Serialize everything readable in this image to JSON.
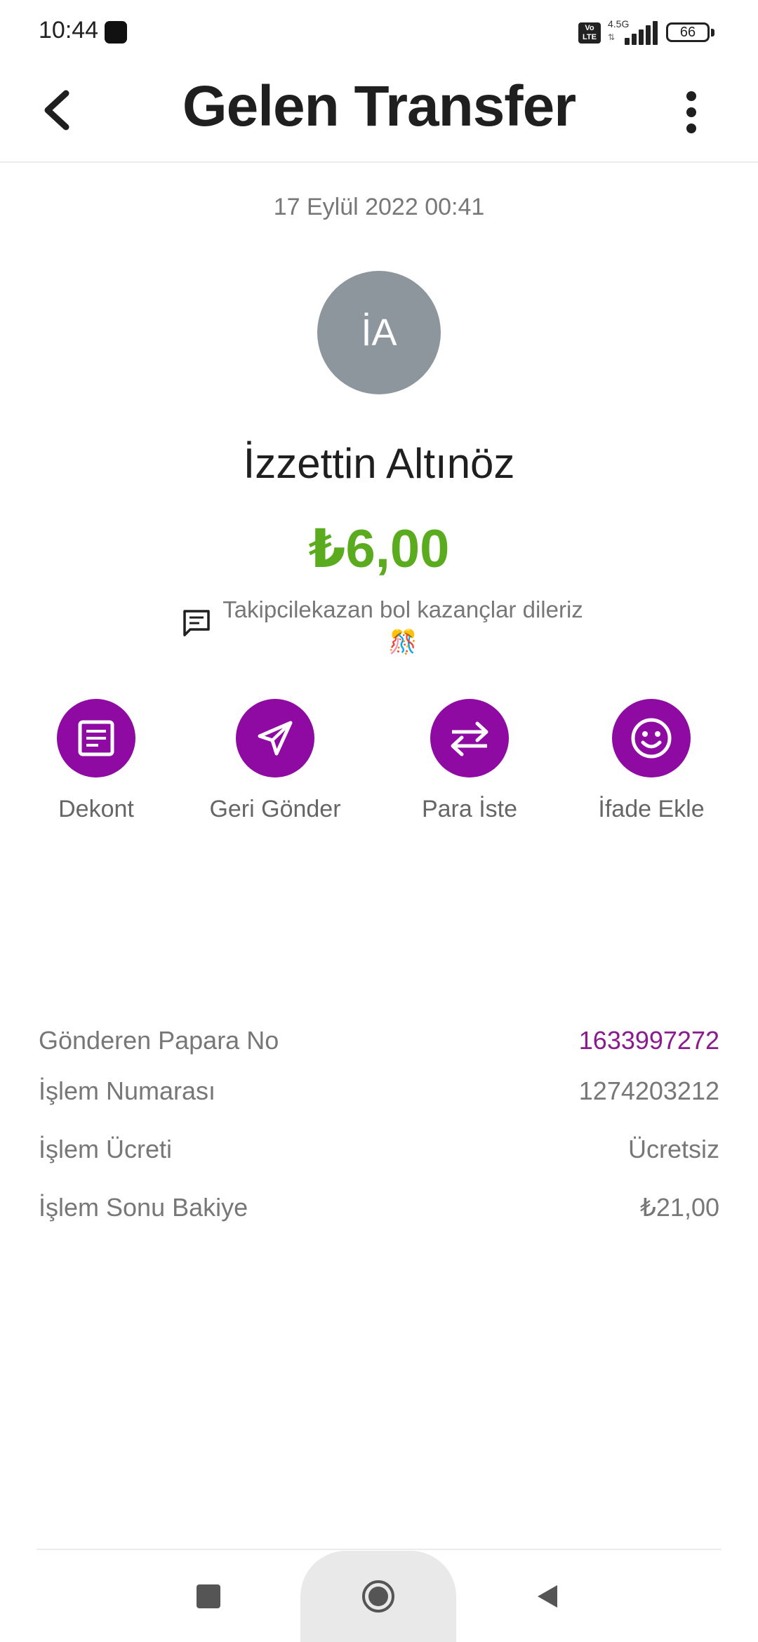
{
  "status_bar": {
    "time": "10:44",
    "volte_badge": "Vo LTE",
    "network_type": "4.5G",
    "battery": "66"
  },
  "header": {
    "title": "Gelen Transfer"
  },
  "transaction": {
    "date": "17 Eylül 2022 00:41",
    "avatar_initials": "İA",
    "sender_name": "İzzettin Altınöz",
    "amount": "₺6,00",
    "message": "Takipcilekazan bol kazançlar dileriz",
    "message_emoji": "🎊"
  },
  "actions": [
    {
      "label": "Dekont",
      "icon": "receipt-icon"
    },
    {
      "label": "Geri Gönder",
      "icon": "send-icon"
    },
    {
      "label": "Para İste",
      "icon": "swap-arrows-icon"
    },
    {
      "label": "İfade Ekle",
      "icon": "smiley-icon"
    }
  ],
  "details": [
    {
      "label": "Gönderen Papara No",
      "value": "1633997272"
    },
    {
      "label": "İşlem Numarası",
      "value": "1274203212"
    },
    {
      "label": "İşlem Ücreti",
      "value": "Ücretsiz"
    },
    {
      "label": "İşlem Sonu Bakiye",
      "value": "₺21,00"
    }
  ],
  "colors": {
    "accent_purple": "#8e0aa3",
    "amount_green": "#5aac1e",
    "avatar_gray": "#8c969c"
  }
}
